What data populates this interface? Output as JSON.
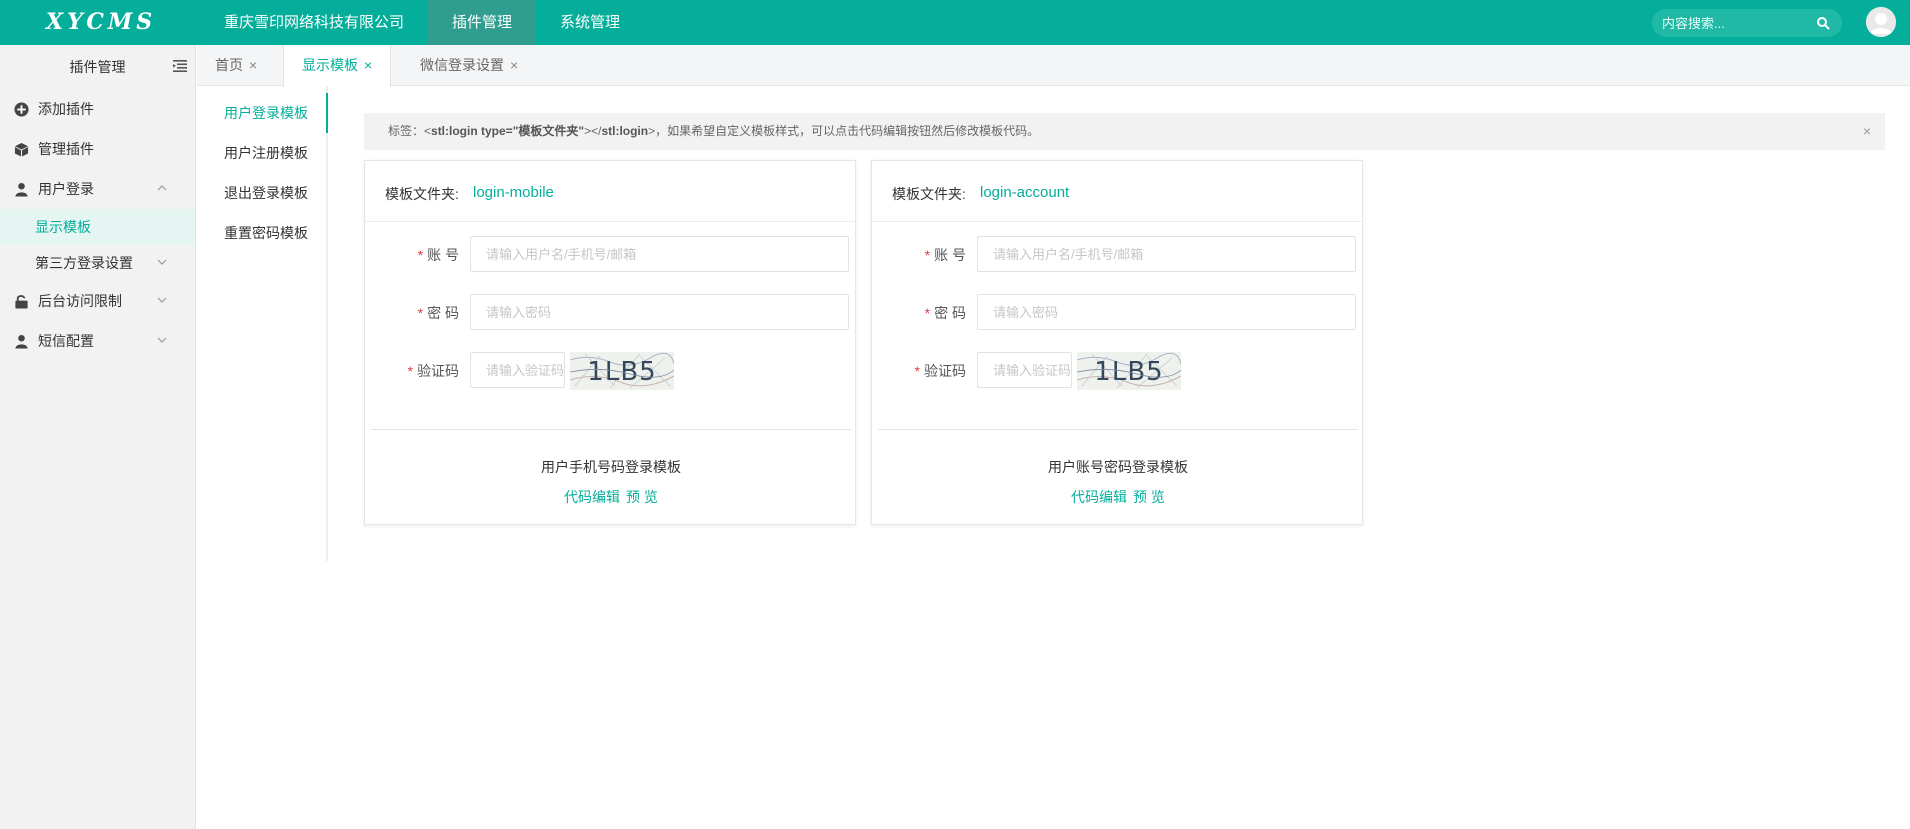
{
  "brand": {
    "logo_text": "XYCMS",
    "accent": "#05ae9a"
  },
  "topnav": {
    "items": [
      {
        "label": "重庆雪印网络科技有限公司"
      },
      {
        "label": "插件管理"
      },
      {
        "label": "系统管理"
      }
    ],
    "active_index": 1
  },
  "search": {
    "placeholder": "内容搜索..."
  },
  "sidebar": {
    "title": "插件管理",
    "items": [
      {
        "label": "添加插件",
        "icon": "plus-circle-icon"
      },
      {
        "label": "管理插件",
        "icon": "cube-icon"
      },
      {
        "label": "用户登录",
        "icon": "user-icon",
        "expanded": true
      },
      {
        "label": "后台访问限制",
        "icon": "unlock-icon"
      },
      {
        "label": "短信配置",
        "icon": "user-icon"
      }
    ],
    "subitems": [
      {
        "label": "显示模板",
        "active": true
      },
      {
        "label": "第三方登录设置"
      }
    ]
  },
  "tabs": [
    {
      "label": "首页",
      "close": "×"
    },
    {
      "label": "显示模板",
      "close": "×",
      "active": true
    },
    {
      "label": "微信登录设置",
      "close": "×"
    }
  ],
  "template_nav": [
    {
      "label": "用户登录模板",
      "active": true
    },
    {
      "label": "用户注册模板"
    },
    {
      "label": "退出登录模板"
    },
    {
      "label": "重置密码模板"
    }
  ],
  "alert": {
    "prefix": "标签：<",
    "tag_open": "stl:login type=\"模板文件夹\"",
    "middle": "></",
    "tag_close": "stl:login",
    "suffix": ">，如果希望自定义模板样式，可以点击代码编辑按钮然后修改模板代码。",
    "close": "×"
  },
  "cards": [
    {
      "folder_label": "模板文件夹:",
      "folder_value": "login-mobile",
      "fields": {
        "account_label": "账 号",
        "account_placeholder": "请输入用户名/手机号/邮箱",
        "password_label": "密 码",
        "password_placeholder": "请输入密码",
        "captcha_label": "验证码",
        "captcha_placeholder": "请输入验证码",
        "required_mark": "*"
      },
      "captcha_text": "1LB5",
      "name": "用户手机号码登录模板",
      "edit_link": "代码编辑",
      "preview_link": "预 览"
    },
    {
      "folder_label": "模板文件夹:",
      "folder_value": "login-account",
      "fields": {
        "account_label": "账 号",
        "account_placeholder": "请输入用户名/手机号/邮箱",
        "password_label": "密 码",
        "password_placeholder": "请输入密码",
        "captcha_label": "验证码",
        "captcha_placeholder": "请输入验证码",
        "required_mark": "*"
      },
      "captcha_text": "1LB5",
      "name": "用户账号密码登录模板",
      "edit_link": "代码编辑",
      "preview_link": "预 览"
    }
  ]
}
